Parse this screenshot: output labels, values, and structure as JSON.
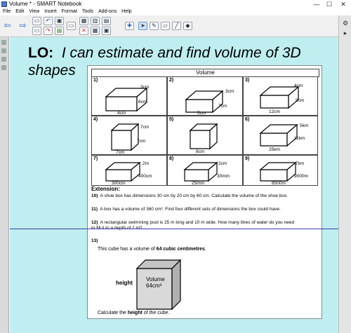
{
  "window": {
    "title": "Volume * - SMART Notebook",
    "controls": [
      "—",
      "☐",
      "✕"
    ]
  },
  "menu": [
    "File",
    "Edit",
    "View",
    "Insert",
    "Format",
    "Tools",
    "Add-ons",
    "Help"
  ],
  "slide": {
    "heading_lo": "LO:",
    "heading_text": "I can estimate and find volume of 3D",
    "heading_text2": "shapes"
  },
  "worksheet": {
    "title": "Volume",
    "cells": [
      {
        "num": "1)",
        "labels": [
          "3cm",
          "6cm",
          "4cm"
        ]
      },
      {
        "num": "2)",
        "labels": [
          "3cm",
          "7cm",
          "5cm"
        ]
      },
      {
        "num": "3)",
        "labels": [
          "4cm",
          "9cm",
          "12cm"
        ]
      },
      {
        "num": "4)",
        "labels": [
          "7cm",
          "7cm",
          "7cm"
        ]
      },
      {
        "num": "5)",
        "labels": [
          "8cm"
        ]
      },
      {
        "num": "6)",
        "labels": [
          "5km",
          "11km",
          "25km"
        ]
      },
      {
        "num": "7)",
        "labels": [
          "2m",
          "400cm",
          "300cm"
        ]
      },
      {
        "num": "8)",
        "labels": [
          "2cm",
          "30mm",
          "25mm"
        ]
      },
      {
        "num": "9)",
        "labels": [
          "7km",
          "9000m",
          "8500m"
        ]
      }
    ],
    "extension": {
      "heading": "Extension:",
      "q10_num": "10)",
      "q10": "A shoe box has dimensions 30 cm by 20 cm by 60 cm. Calculate the volume of the shoe box.",
      "q11_num": "11)",
      "q11": "A box has a volume of 360 cm³. Find four different sets of dimensions the box could have.",
      "q12_num": "12)",
      "q12a": "A rectangular swimming pool is 25 m long and 10 m wide. How many litres of water do you need",
      "q12b": "to fill it to a depth of 2 m?",
      "q13_num": "13)",
      "q13_intro": "This cube has a volume of",
      "q13_bold": "64 cubic centimetres",
      "q13_end": ".",
      "cube_label1": "Volume",
      "cube_label2": "64cm³",
      "height_label": "height",
      "q13_bottom_pre": "Calculate the",
      "q13_bottom_bold": "height",
      "q13_bottom_post": "of the cube."
    }
  },
  "icons": {
    "select": "pointer-icon",
    "pen": "pen-icon",
    "eraser": "eraser-icon"
  }
}
